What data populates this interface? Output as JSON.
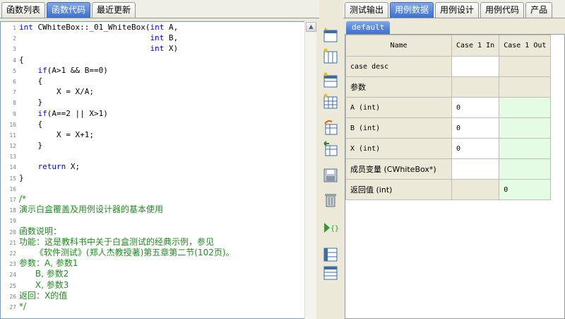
{
  "left_tabs": [
    "函数列表",
    "函数代码",
    "最近更新"
  ],
  "left_active": 1,
  "right_tabs": [
    "测试输出",
    "用例数据",
    "用例设计",
    "用例代码",
    "产品"
  ],
  "right_active": 1,
  "sheet_tab": "default",
  "code_lines": [
    {
      "n": "1",
      "t": "int CWhiteBox::_01_WhiteBox(int A,",
      "c": false
    },
    {
      "n": "2",
      "t": "                            int B,",
      "c": false
    },
    {
      "n": "3",
      "t": "                            int X)",
      "c": false
    },
    {
      "n": "4",
      "t": "{",
      "c": false
    },
    {
      "n": "5",
      "t": "    if(A>1 && B==0)",
      "c": false
    },
    {
      "n": "6",
      "t": "    {",
      "c": false
    },
    {
      "n": "7",
      "t": "        X = X/A;",
      "c": false
    },
    {
      "n": "8",
      "t": "    }",
      "c": false
    },
    {
      "n": "9",
      "t": "    if(A==2 || X>1)",
      "c": false
    },
    {
      "n": "10",
      "t": "    {",
      "c": false
    },
    {
      "n": "11",
      "t": "        X = X+1;",
      "c": false
    },
    {
      "n": "12",
      "t": "    }",
      "c": false
    },
    {
      "n": "13",
      "t": "",
      "c": false
    },
    {
      "n": "14",
      "t": "    return X;",
      "c": false
    },
    {
      "n": "15",
      "t": "}",
      "c": false
    },
    {
      "n": "16",
      "t": "",
      "c": false
    },
    {
      "n": "17",
      "t": "/*",
      "c": true
    },
    {
      "n": "18",
      "t": "演示白盒覆盖及用例设计器的基本使用",
      "c": true
    },
    {
      "n": "19",
      "t": "",
      "c": true
    },
    {
      "n": "20",
      "t": "函数说明：",
      "c": true
    },
    {
      "n": "21",
      "t": "功能：这是教科书中关于白盒测试的经典示例，参见",
      "c": true
    },
    {
      "n": "22",
      "t": "      《软件测试》(郑人杰教授著)第五章第二节(102页)。",
      "c": true
    },
    {
      "n": "23",
      "t": "参数：A, 参数1",
      "c": true
    },
    {
      "n": "24",
      "t": "      B, 参数2",
      "c": true
    },
    {
      "n": "25",
      "t": "      X, 参数3",
      "c": true
    },
    {
      "n": "26",
      "t": "返回：X的值",
      "c": true
    },
    {
      "n": "27",
      "t": "*/",
      "c": true
    }
  ],
  "grid": {
    "headers": [
      "Name",
      "Case 1 In",
      "Case 1 Out"
    ],
    "rows": [
      {
        "name": "case desc",
        "in": "",
        "out": "",
        "cn": false,
        "in_gray": false,
        "out_gray": true
      },
      {
        "name": "参数",
        "in": "",
        "out": "",
        "cn": true,
        "in_gray": true,
        "out_gray": true
      },
      {
        "name": "A (int)",
        "in": "0",
        "out": "",
        "cn": false,
        "in_gray": false,
        "out_gray": false
      },
      {
        "name": "B (int)",
        "in": "0",
        "out": "",
        "cn": false,
        "in_gray": false,
        "out_gray": false
      },
      {
        "name": "X (int)",
        "in": "0",
        "out": "",
        "cn": false,
        "in_gray": false,
        "out_gray": false
      },
      {
        "name": "成员变量 (CWhiteBox*)",
        "in": "",
        "out": "",
        "cn": true,
        "in_gray": false,
        "out_gray": false
      },
      {
        "name": "返回值 (int)",
        "in": "",
        "out": "0",
        "cn": true,
        "in_gray": true,
        "out_gray": false
      }
    ]
  },
  "toolbar_icons": [
    "insert-row-icon",
    "insert-column-icon",
    "insert-table-icon",
    "insert-grid-icon",
    "import-icon",
    "export-icon",
    "save-icon",
    "delete-icon",
    "run-icon",
    "table-view-icon",
    "list-view-icon"
  ]
}
